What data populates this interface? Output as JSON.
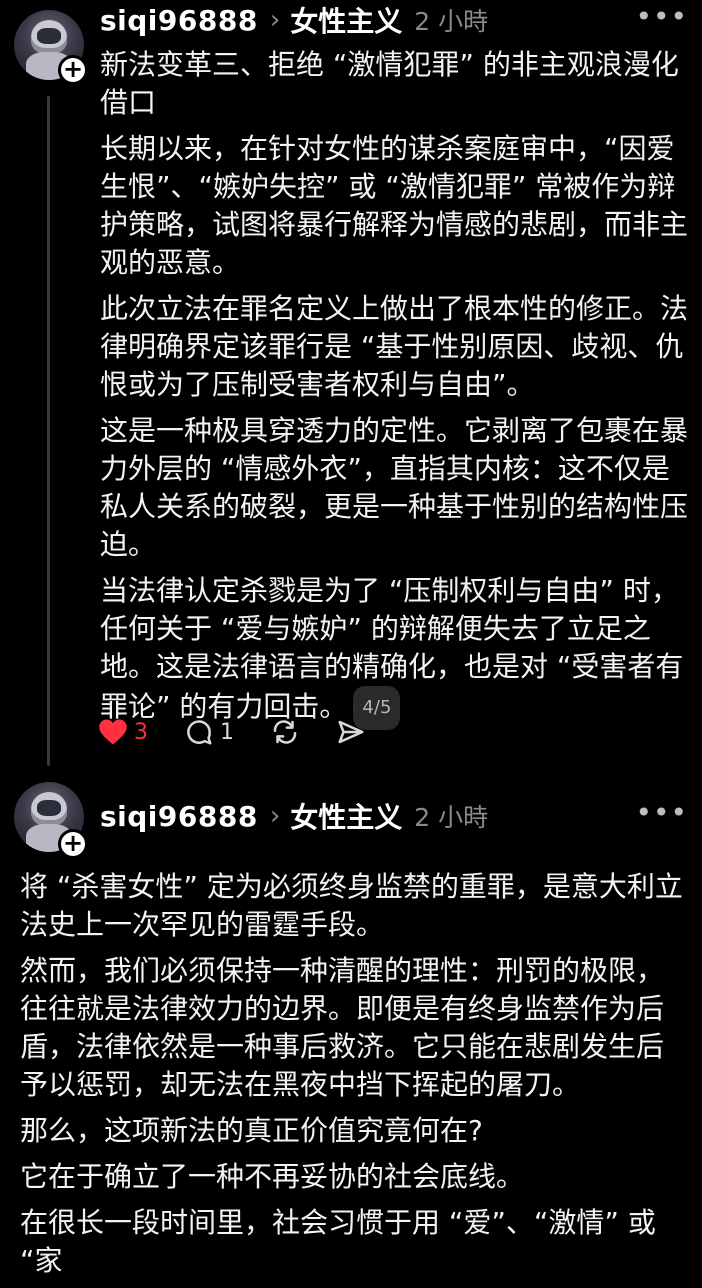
{
  "posts": [
    {
      "username": "siqi96888",
      "topic": "女性主义",
      "time": "2 小時",
      "paragraphs": [
        "新法变革三、拒绝 “激情犯罪” 的非主观浪漫化借口",
        "长期以来，在针对女性的谋杀案庭审中，“因爱生恨”、“嫉妒失控” 或 “激情犯罪” 常被作为辩护策略，试图将暴行解释为情感的悲剧，而非主观的恶意。",
        "此次立法在罪名定义上做出了根本性的修正。法律明确界定该罪行是 “基于性别原因、歧视、仇恨或为了压制受害者权利与自由”。",
        "这是一种极具穿透力的定性。它剥离了包裹在暴力外层的 “情感外衣”，直指其内核：这不仅是私人关系的破裂，更是一种基于性别的结构性压迫。",
        "当法律认定杀戮是为了 “压制权利与自由” 时，任何关于 “爱与嫉妒” 的辩解便失去了立足之地。这是法律语言的精确化，也是对 “受害者有罪论” 的有力回击。"
      ],
      "pager": "4/5",
      "likes": "3",
      "replies": "1",
      "like_color": "#ff3040"
    },
    {
      "username": "siqi96888",
      "topic": "女性主义",
      "time": "2 小時",
      "paragraphs": [
        "将 “杀害女性” 定为必须终身监禁的重罪，是意大利立法史上一次罕见的雷霆手段。",
        "然而，我们必须保持一种清醒的理性：刑罚的极限，往往就是法律效力的边界。即便是有终身监禁作为后盾，法律依然是一种事后救济。它只能在悲剧发生后予以惩罚，却无法在黑夜中挡下挥起的屠刀。",
        "那么，这项新法的真正价值究竟何在?",
        "它在于确立了一种不再妥协的社会底线。",
        "在很长一段时间里，社会习惯于用 “爱”、“激情” 或 “家"
      ]
    }
  ]
}
